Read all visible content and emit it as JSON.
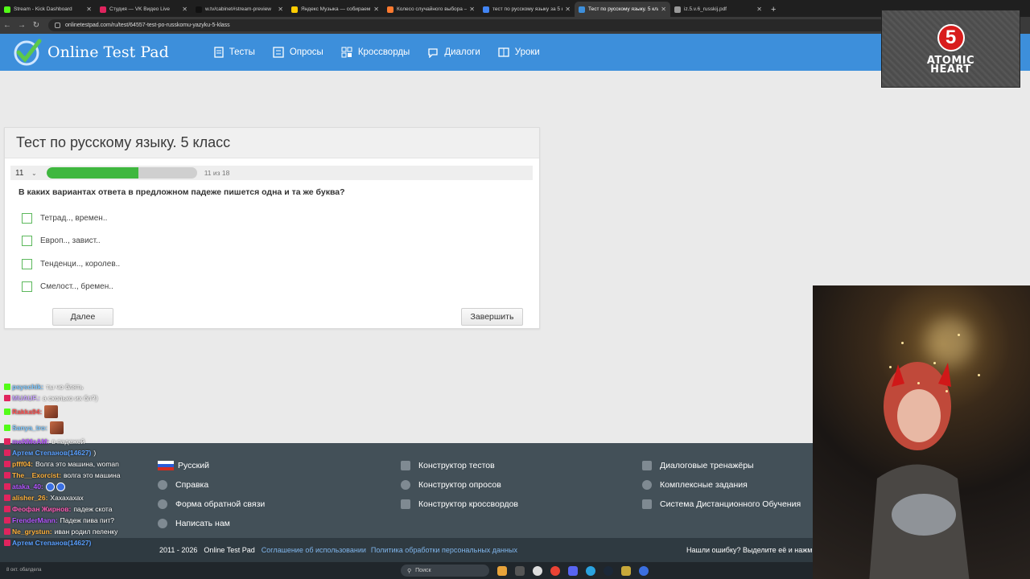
{
  "browser": {
    "tabs": [
      {
        "label": "Stream - Kick Dashboard",
        "color": "#53fc18"
      },
      {
        "label": "Студия — VK Видео Live",
        "color": "#e0245e"
      },
      {
        "label": "w.tv/cabinet#stream-preview",
        "color": "#111111"
      },
      {
        "label": "Яндекс Музыка — собираем м",
        "color": "#ffcc00"
      },
      {
        "label": "Колесо случайного выбора – С",
        "color": "#ff7a2f"
      },
      {
        "label": "тест по русскому языку за 5 кл",
        "color": "#4285f4"
      },
      {
        "label": "Тест по русскому языку. 5 клас",
        "color": "#3d8fdb",
        "active": true
      },
      {
        "label": "iz.5.v.6_russkij.pdf",
        "color": "#999999"
      }
    ],
    "url": "onlinetestpad.com/ru/test/64557-test-po-russkomu-yazyku-5-klass"
  },
  "site": {
    "logo_text": "Online Test Pad",
    "nav": [
      "Тесты",
      "Опросы",
      "Кроссворды",
      "Диалоги",
      "Уроки"
    ]
  },
  "quiz": {
    "title": "Тест по русскому языку. 5 класс",
    "current_question": "11",
    "progress_text": "11 из 18",
    "progress_fraction": 0.611,
    "question": "В каких вариантах ответа в предложном падеже пишется одна и та же буква?",
    "options": [
      "Тетрад.., времен..",
      "Европ.., завист..",
      "Тенденци.., королев..",
      "Смелост.., бремен.."
    ],
    "next_label": "Далее",
    "finish_label": "Завершить"
  },
  "footer": {
    "col1": [
      "Русский",
      "Справка",
      "Форма обратной связи",
      "Написать нам"
    ],
    "col2": [
      "Конструктор тестов",
      "Конструктор опросов",
      "Конструктор кроссвордов"
    ],
    "col3": [
      "Диалоговые тренажёры",
      "Комплексные задания",
      "Система Дистанционного Обучения"
    ],
    "copyright": "2011 - 2026",
    "brand": "Online Test Pad",
    "link1": "Соглашение об использовании",
    "link2": "Политика обработки персональных данных",
    "error_note": "Нашли ошибку? Выделите её и нажм"
  },
  "chat": [
    {
      "nick": "psyschik:",
      "text": "ты чо блять",
      "nick_color": "#7ec8ff",
      "badge": "#53fc18"
    },
    {
      "nick": "MUAUF.:",
      "text": "а сколько их бл?)",
      "nick_color": "#c8a4ff",
      "badge": "#e0245e"
    },
    {
      "nick": "Rakka94:",
      "text": "",
      "nick_color": "#ff4f4f",
      "badge": "#53fc18",
      "emote": true
    },
    {
      "nick": "Sanya_tro:",
      "text": "",
      "nick_color": "#7ec8ff",
      "badge": "#53fc18",
      "emote": true
    },
    {
      "nick": "meNMeAM:",
      "text": "в падежей",
      "nick_color": "#b455ff",
      "badge": "#e0245e"
    },
    {
      "nick": "Артем Степанов(14627)",
      "text": ")",
      "nick_color": "#5aa0ff",
      "badge": "#e0245e"
    },
    {
      "nick": "pfff04:",
      "text": "Волга это машина, woman",
      "nick_color": "#ffb13b",
      "badge": "#e0245e"
    },
    {
      "nick": "The__Exorcist:",
      "text": "волга это машина",
      "nick_color": "#ffb13b",
      "badge": "#e0245e"
    },
    {
      "nick": "ataka_40:",
      "text": "",
      "nick_color": "#b455ff",
      "badge": "#e0245e",
      "emote2": true
    },
    {
      "nick": "alisher_26:",
      "text": "Хахахахах",
      "nick_color": "#ffb13b",
      "badge": "#e0245e"
    },
    {
      "nick": "Феофан Жирнов:",
      "text": "падеж скота",
      "nick_color": "#ff5ab4",
      "badge": "#e0245e"
    },
    {
      "nick": "FrenderMann:",
      "text": "Падеж пива пит?",
      "nick_color": "#b455ff",
      "badge": "#e0245e"
    },
    {
      "nick": "Ne_grystun:",
      "text": "иван родил пеленку",
      "nick_color": "#ffb13b",
      "badge": "#e0245e"
    },
    {
      "nick": "Артем Степанов(14627)",
      "text": "",
      "nick_color": "#5aa0ff",
      "badge": "#e0245e"
    }
  ],
  "overlay": {
    "brand_number": "5",
    "game_title_line1": "ATOMIC",
    "game_title_line2": "HEART"
  },
  "taskbar": {
    "search_placeholder": "Поиск",
    "status_text": "8 окт. обалдела"
  }
}
